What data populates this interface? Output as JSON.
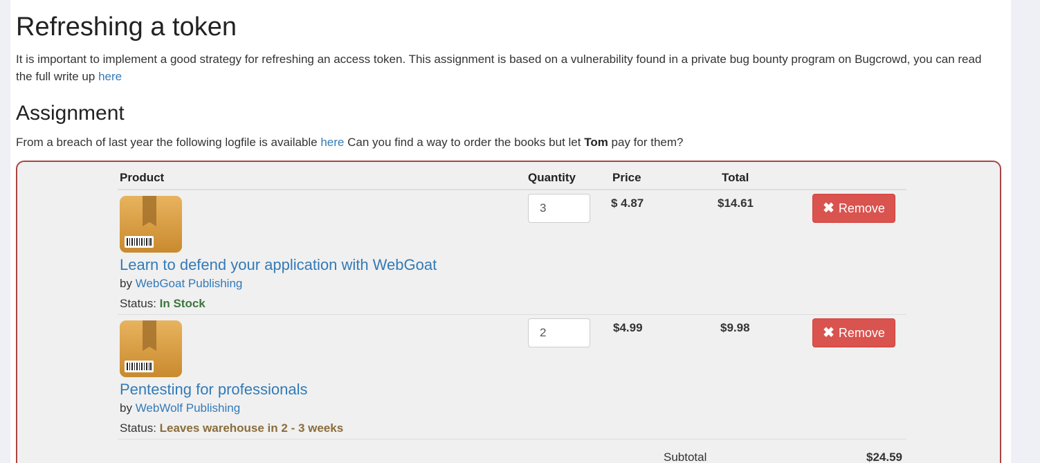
{
  "page": {
    "title": "Refreshing a token",
    "intro_text": "It is important to implement a good strategy for refreshing an access token. This assignment is based on a vulnerability found in a private bug bounty program on Bugcrowd, you can read the full write up ",
    "intro_link": "here",
    "section_title": "Assignment",
    "assignment_prefix": "From a breach of last year the following logfile is available ",
    "assignment_link": "here",
    "assignment_middle": " Can you find a way to order the books but let ",
    "assignment_bold": "Tom",
    "assignment_suffix": " pay for them?"
  },
  "cart": {
    "headers": {
      "product": "Product",
      "quantity": "Quantity",
      "price": "Price",
      "total": "Total"
    },
    "items": [
      {
        "name": "Learn to defend your application with WebGoat",
        "by_label": "by ",
        "publisher": "WebGoat Publishing",
        "status_label": "Status: ",
        "status": "In Stock",
        "quantity": "3",
        "price": "$ 4.87",
        "total": "$14.61",
        "remove_label": "Remove",
        "remove_icon": "✖"
      },
      {
        "name": "Pentesting for professionals",
        "by_label": "by ",
        "publisher": "WebWolf Publishing",
        "status_label": "Status: ",
        "status": "Leaves warehouse in 2 - 3 weeks",
        "quantity": "2",
        "price": "$4.99",
        "total": "$9.98",
        "remove_label": "Remove",
        "remove_icon": "✖"
      }
    ],
    "subtotal_label": "Subtotal",
    "subtotal_value": "$24.59"
  },
  "icons": {
    "product_thumb": "package-icon",
    "remove": "close-icon"
  },
  "colors": {
    "link": "#337ab7",
    "danger": "#d9534f",
    "status_in_stock": "#3c763d",
    "status_delayed": "#8a6d3b",
    "attack_border": "#a94442"
  }
}
